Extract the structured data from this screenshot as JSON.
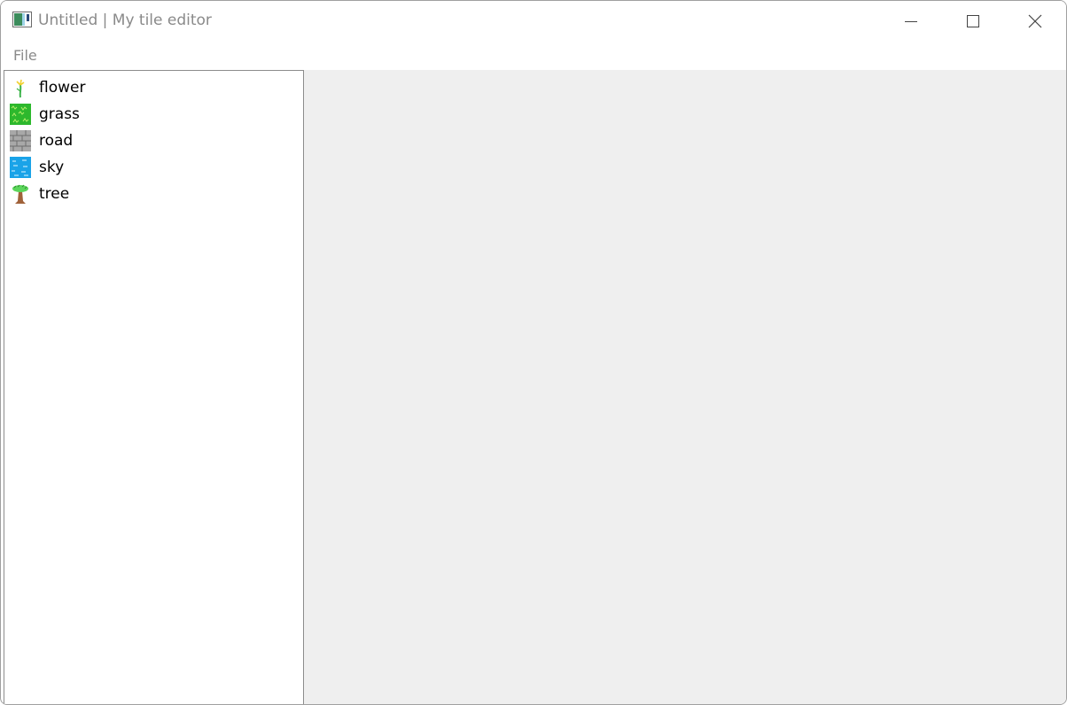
{
  "window": {
    "title": "Untitled | My tile editor",
    "app_icon": "tile-editor-app-icon",
    "controls": {
      "minimize_icon": "minimize-icon",
      "maximize_icon": "maximize-icon",
      "close_icon": "close-icon"
    }
  },
  "menubar": {
    "items": [
      {
        "label": "File"
      }
    ]
  },
  "tile_palette": {
    "items": [
      {
        "label": "flower",
        "icon": "flower-icon"
      },
      {
        "label": "grass",
        "icon": "grass-icon"
      },
      {
        "label": "road",
        "icon": "road-icon"
      },
      {
        "label": "sky",
        "icon": "sky-icon"
      },
      {
        "label": "tree",
        "icon": "tree-icon"
      }
    ]
  },
  "colors": {
    "canvas_background": "#efefef",
    "grass": "#2db82d",
    "road": "#a8a8a8",
    "sky": "#1aa3e8",
    "tree_trunk": "#a0623a",
    "foliage": "#5cd65c",
    "title_text": "#8a8a8a"
  }
}
